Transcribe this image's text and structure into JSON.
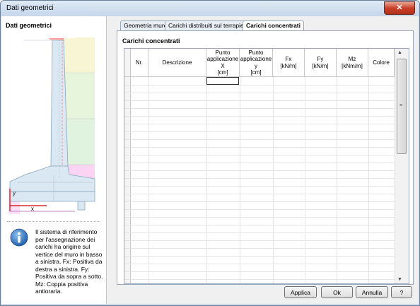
{
  "window": {
    "title": "Dati geometrici",
    "close_label": "✕"
  },
  "left_panel": {
    "title": "Dati geometrici",
    "axis_y": "y",
    "axis_x": "x",
    "info_text": "Il sistema di riferimento per l'assegnazione dei carichi ha origine sul vertice del muro in basso a sinistra. Fx: Positiva da destra a sinistra. Fy: Positiva da sopra a sotto. Mz: Coppia positiva antioraria."
  },
  "tabs": [
    {
      "label": "Geometria muro",
      "active": false
    },
    {
      "label": "Carichi distribuiti sul terrapieno",
      "active": false
    },
    {
      "label": "Carichi concentrati",
      "active": true
    }
  ],
  "group_title": "Carichi concentrati",
  "table": {
    "columns": [
      {
        "l1": "",
        "l2": "",
        "l3": "",
        "l4": ""
      },
      {
        "l1": "Nr.",
        "l2": "",
        "l3": "",
        "l4": ""
      },
      {
        "l1": "Descrizione",
        "l2": "",
        "l3": "",
        "l4": ""
      },
      {
        "l1": "Punto",
        "l2": "applicazione",
        "l3": "X",
        "l4": "[cm]"
      },
      {
        "l1": "Punto",
        "l2": "applicazione",
        "l3": "y",
        "l4": "[cm]"
      },
      {
        "l1": "Fx",
        "l2": "[kN/m]",
        "l3": "",
        "l4": ""
      },
      {
        "l1": "Fy",
        "l2": "[kN/m]",
        "l3": "",
        "l4": ""
      },
      {
        "l1": "Mz",
        "l2": "[kNm/m]",
        "l3": "",
        "l4": ""
      },
      {
        "l1": "Colore",
        "l2": "",
        "l3": "",
        "l4": ""
      }
    ],
    "scroll_up": "▲",
    "scroll_down": "▼",
    "scroll_grip": "≡"
  },
  "buttons": {
    "apply": "Applica",
    "ok": "Ok",
    "cancel": "Annulla",
    "help": "?"
  }
}
